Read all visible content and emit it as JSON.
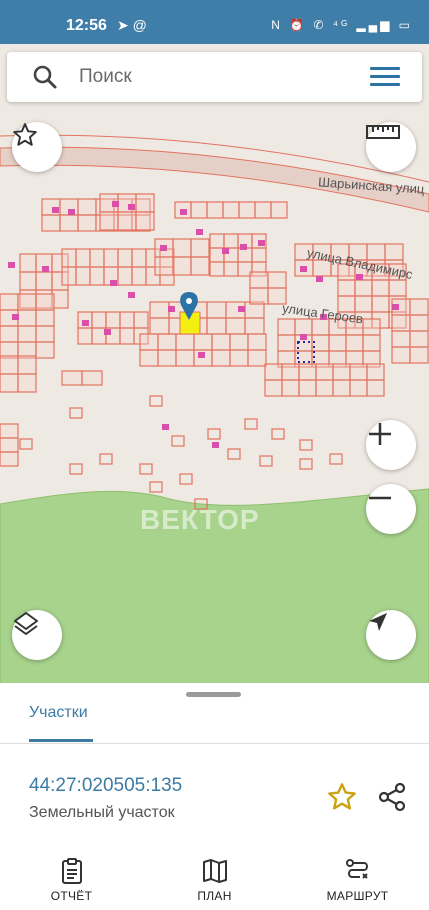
{
  "status_bar": {
    "time": "12:56",
    "app_icons": "➤ @",
    "system_icons": "N ⏰ ✆ ⁴ᴳ ▂▄▆ ▭"
  },
  "search": {
    "placeholder": "Поиск"
  },
  "map": {
    "streets": [
      "Шарьинская улиц",
      "улица Владимирс",
      "улица Героев"
    ],
    "watermark": "ВЕКТОР",
    "icons": {
      "favorite": "star-icon",
      "ruler": "ruler-icon",
      "zoom_in": "plus-icon",
      "zoom_out": "minus-icon",
      "layers": "layers-icon",
      "locate": "navigation-arrow-icon",
      "marker": "location-pin-icon"
    },
    "colors": {
      "land": "#efe9e3",
      "forest": "#a7d38c",
      "parcel_border": "#e2735e",
      "parcel_fill": "#f6d7cf",
      "building": "#d94fa9",
      "selected": "#f3ef12",
      "pin": "#2c72a6"
    }
  },
  "sheet": {
    "tab_label": "Участки",
    "parcel_number": "44:27:020505:135",
    "parcel_type": "Земельный участок"
  },
  "nav": {
    "items": [
      {
        "label": "ОТЧЁТ",
        "icon": "report-icon"
      },
      {
        "label": "ПЛАН",
        "icon": "map-plan-icon"
      },
      {
        "label": "МАРШРУТ",
        "icon": "route-icon"
      }
    ]
  },
  "accent": "#3c7ba4"
}
